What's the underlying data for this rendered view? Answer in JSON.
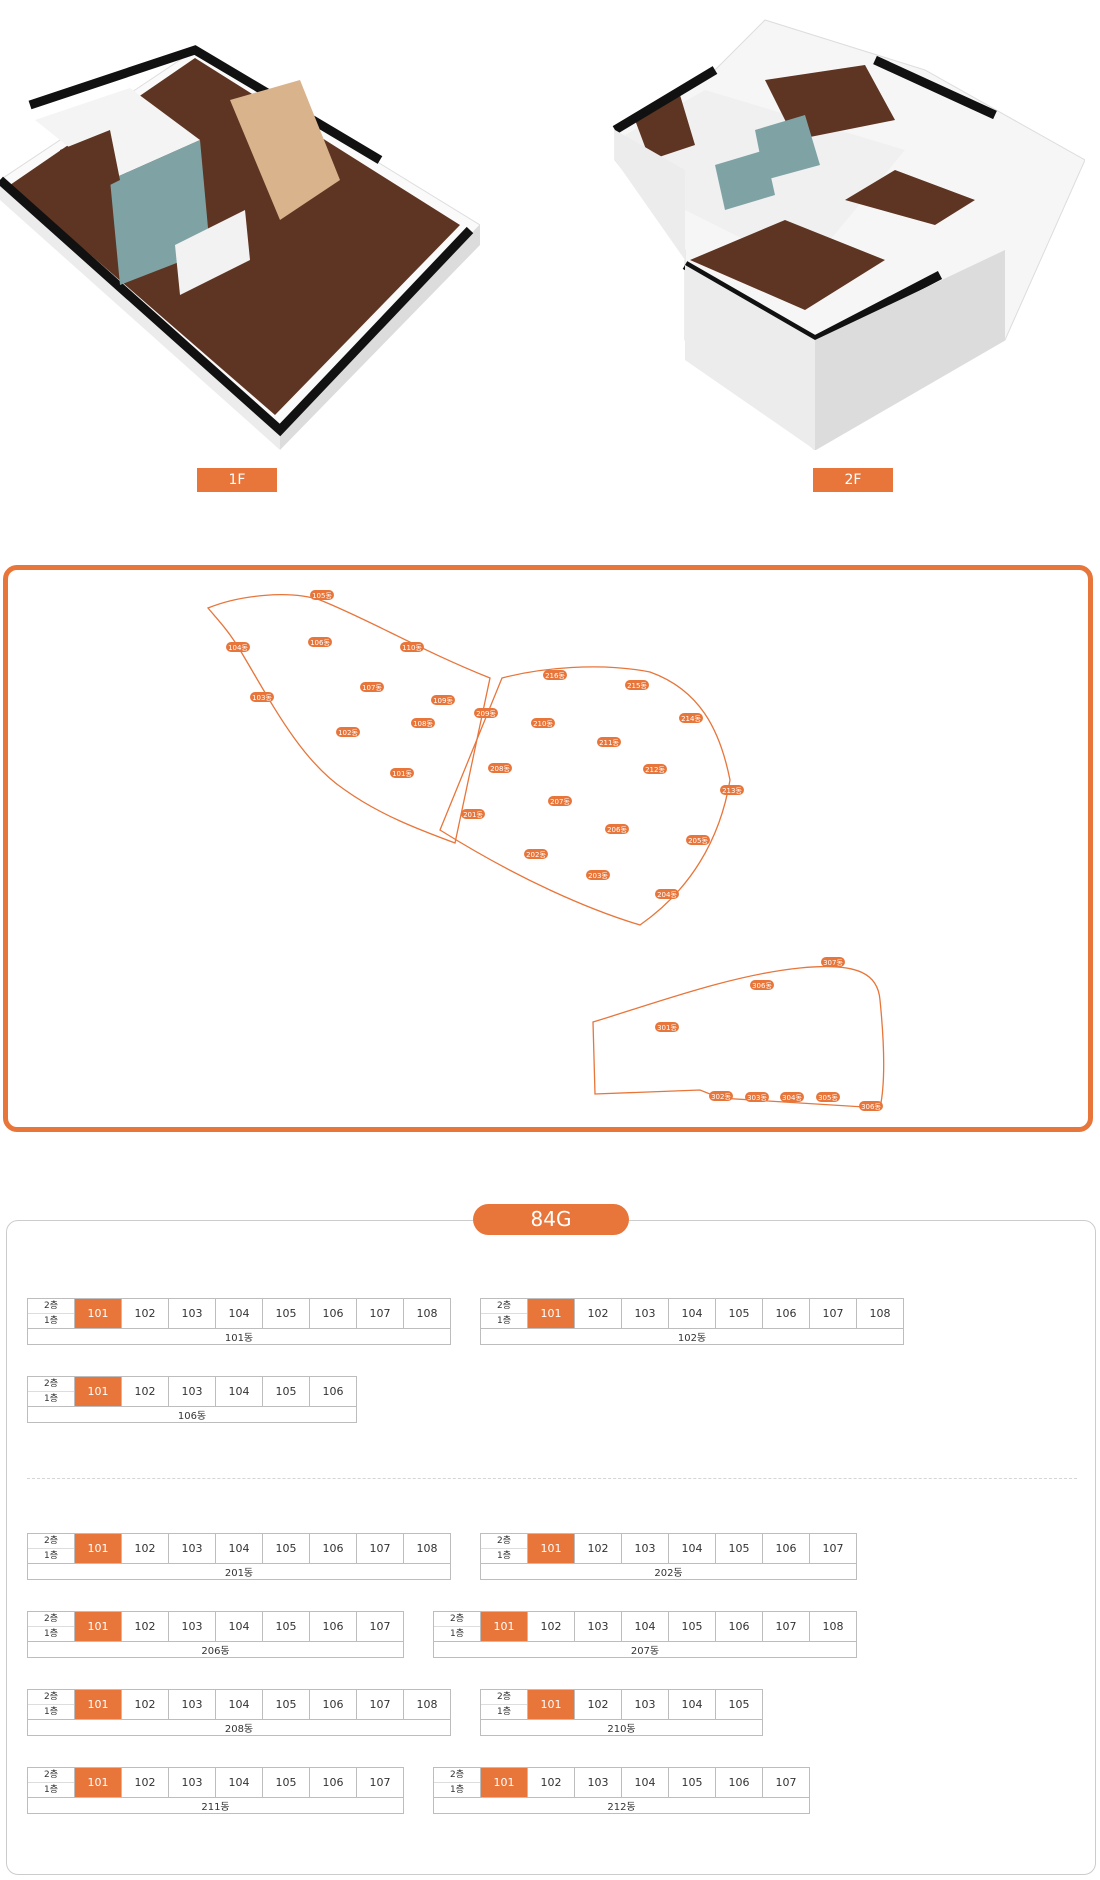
{
  "floorplans": {
    "first": {
      "label": "1F"
    },
    "second": {
      "label": "2F"
    }
  },
  "map": {
    "buildings_a": [
      "105동",
      "104동",
      "106동",
      "110동",
      "103동",
      "107동",
      "109동",
      "209동",
      "102동",
      "108동",
      "101동",
      "216동",
      "215동",
      "214동",
      "210동",
      "211동",
      "212동",
      "213동",
      "208동",
      "207동",
      "201동",
      "206동",
      "205동",
      "202동",
      "203동",
      "204동"
    ],
    "buildings_b": [
      "307동",
      "306동",
      "301동",
      "302동",
      "303동",
      "304동",
      "305동",
      "306동"
    ]
  },
  "section": {
    "title": "84G",
    "floor_top": "2층",
    "floor_bottom": "1층",
    "groups": [
      [
        {
          "name": "101동",
          "units": [
            "101",
            "102",
            "103",
            "104",
            "105",
            "106",
            "107",
            "108"
          ],
          "selected": "101"
        },
        {
          "name": "102동",
          "units": [
            "101",
            "102",
            "103",
            "104",
            "105",
            "106",
            "107",
            "108"
          ],
          "selected": "101"
        },
        {
          "name": "106동",
          "units": [
            "101",
            "102",
            "103",
            "104",
            "105",
            "106"
          ],
          "selected": "101"
        }
      ],
      [
        {
          "name": "201동",
          "units": [
            "101",
            "102",
            "103",
            "104",
            "105",
            "106",
            "107",
            "108"
          ],
          "selected": "101"
        },
        {
          "name": "202동",
          "units": [
            "101",
            "102",
            "103",
            "104",
            "105",
            "106",
            "107"
          ],
          "selected": "101"
        },
        {
          "name": "206동",
          "units": [
            "101",
            "102",
            "103",
            "104",
            "105",
            "106",
            "107"
          ],
          "selected": "101"
        },
        {
          "name": "207동",
          "units": [
            "101",
            "102",
            "103",
            "104",
            "105",
            "106",
            "107",
            "108"
          ],
          "selected": "101"
        },
        {
          "name": "208동",
          "units": [
            "101",
            "102",
            "103",
            "104",
            "105",
            "106",
            "107",
            "108"
          ],
          "selected": "101"
        },
        {
          "name": "210동",
          "units": [
            "101",
            "102",
            "103",
            "104",
            "105"
          ],
          "selected": "101"
        },
        {
          "name": "211동",
          "units": [
            "101",
            "102",
            "103",
            "104",
            "105",
            "106",
            "107"
          ],
          "selected": "101"
        },
        {
          "name": "212동",
          "units": [
            "101",
            "102",
            "103",
            "104",
            "105",
            "106",
            "107"
          ],
          "selected": "101"
        }
      ]
    ]
  },
  "colors": {
    "accent": "#e8753a",
    "wall": "#111111",
    "floor_wood": "#6b3b25",
    "tile": "#7fa3a5"
  }
}
